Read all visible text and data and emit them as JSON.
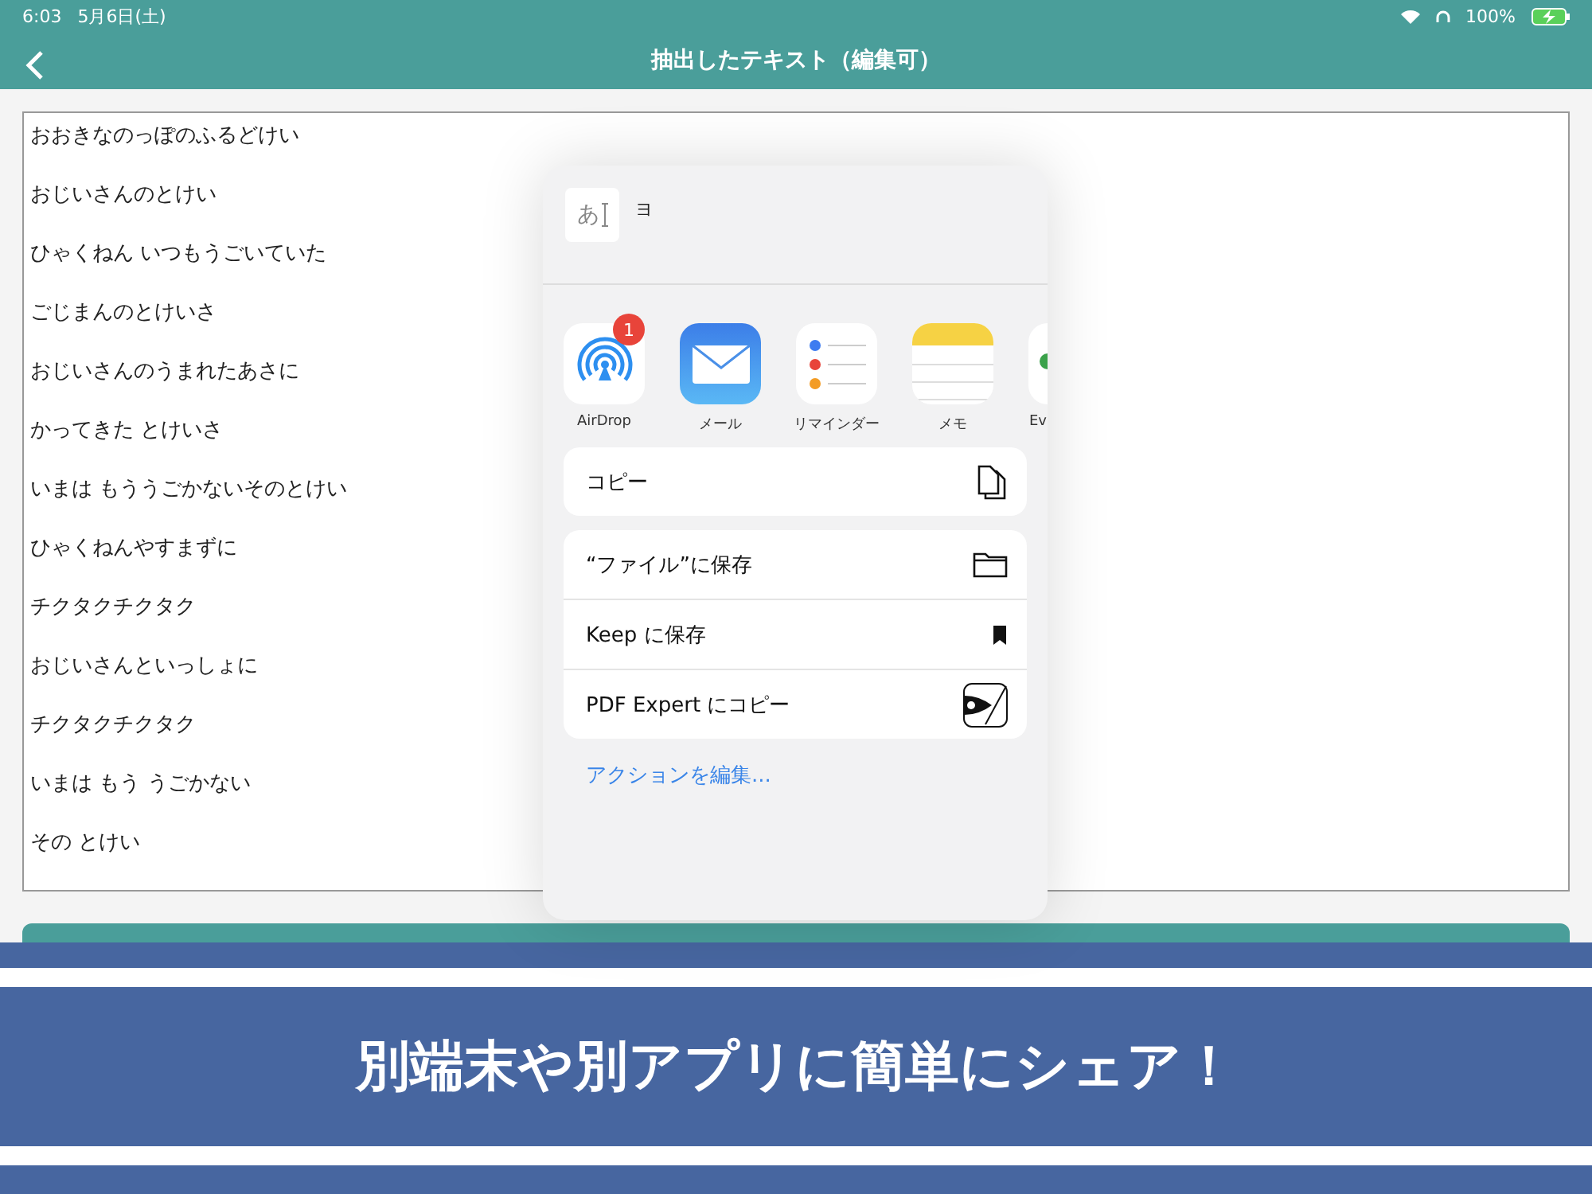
{
  "status_bar": {
    "time": "6:03",
    "date": "5月6日(土)",
    "battery": "100%"
  },
  "nav": {
    "title": "抽出したテキスト（編集可）"
  },
  "text_lines": [
    "おおきなのっぽのふるどけい",
    "おじいさんのとけい",
    "ひゃくねん いつもうごいていた",
    "ごじまんのとけいさ",
    "おじいさんのうまれたあさに",
    "かってきた とけいさ",
    "いまは  もううごかないそのとけい",
    "ひゃくねんやすまずに",
    "チクタクチクタク",
    "おじいさんといっしょに",
    "チクタクチクタク",
    "いまは  もう うごかない",
    "その とけい"
  ],
  "share_sheet": {
    "preview_char": "あ",
    "title": "ヨ",
    "apps": [
      {
        "kind": "airdrop",
        "name": "AirDrop",
        "badge": "1"
      },
      {
        "kind": "mail",
        "name": "メール"
      },
      {
        "kind": "reminders",
        "name": "リマインダー"
      },
      {
        "kind": "notes",
        "name": "メモ"
      },
      {
        "kind": "partial",
        "name": "Ev"
      }
    ],
    "action_groups": [
      [
        {
          "kind": "copy",
          "label": "コピー"
        }
      ],
      [
        {
          "kind": "folder",
          "label": "“ファイル”に保存"
        },
        {
          "kind": "bookmark",
          "label": "Keep に保存"
        },
        {
          "kind": "pdf",
          "label": "PDF Expert にコピー"
        }
      ]
    ],
    "edit_link": "アクションを編集..."
  },
  "banner": {
    "text": "別端末や別アプリに簡単にシェア！"
  }
}
